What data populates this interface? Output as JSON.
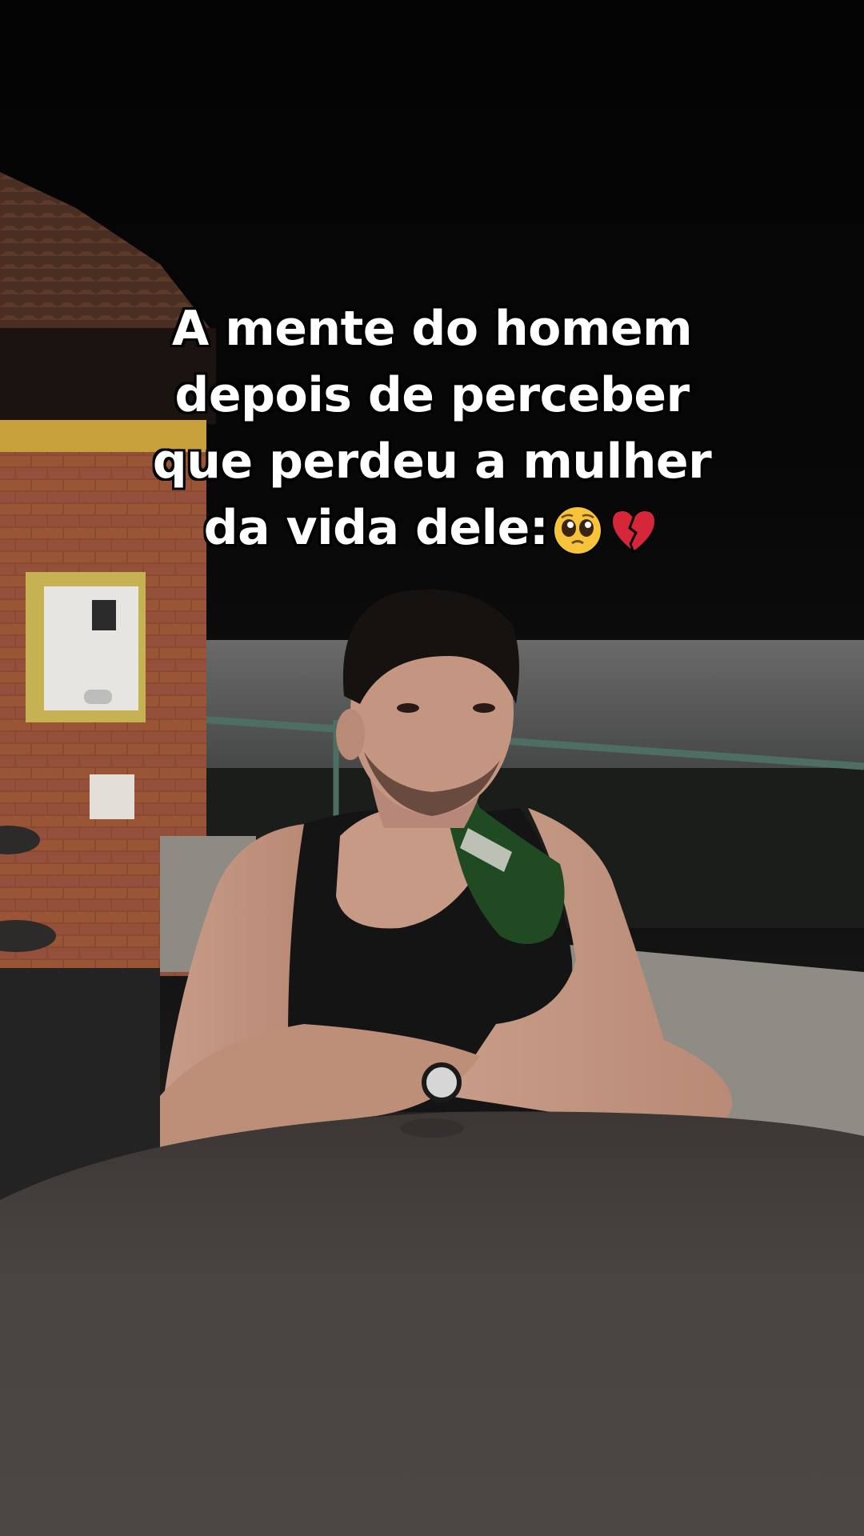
{
  "caption": {
    "line1": "A mente do homem",
    "line2": "depois de perceber",
    "line3": "que perdeu a mulher",
    "line4": "da vida dele:"
  },
  "emojis": [
    "pleading-face-icon",
    "broken-heart-icon"
  ],
  "colors": {
    "caption_text": "#ffffff",
    "caption_outline": "#000000",
    "night_sky": "#050505",
    "brick_wall": "#8a4a30",
    "table_top": "#4a4542",
    "tank_top": "#141414",
    "bottle": "#1f4a22"
  }
}
